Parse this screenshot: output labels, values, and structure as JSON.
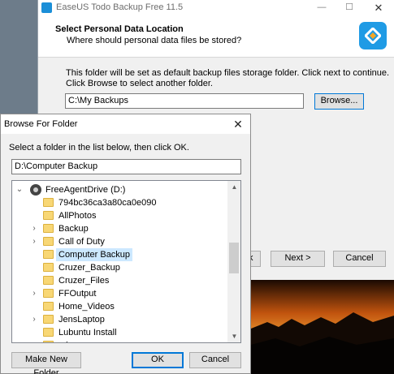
{
  "installer": {
    "title": "EaseUS Todo Backup Free 11.5",
    "heading": "Select Personal Data Location",
    "subheading": "Where should personal data files be stored?",
    "description_line1": "This folder will be set as default backup files storage folder. Click next to continue.",
    "description_line2": "Click Browse to select another folder.",
    "path_value": "C:\\My Backups",
    "browse_label": "Browse...",
    "back_label": "k",
    "next_label": "Next >",
    "cancel_label": "Cancel",
    "window_controls": {
      "minimize": "—",
      "maximize": "☐",
      "close": "✕"
    },
    "logo_icon": "easeus-logo-icon",
    "brand_color": "#1f9be5"
  },
  "dialog": {
    "title": "Browse For Folder",
    "close_glyph": "✕",
    "instruction": "Select a folder in the list below, then click OK.",
    "path": "D:\\Computer Backup",
    "drive": "FreeAgentDrive (D:)",
    "folders": [
      {
        "name": "794bc36ca3a80ca0e090",
        "expandable": false,
        "selected": false
      },
      {
        "name": "AllPhotos",
        "expandable": false,
        "selected": false
      },
      {
        "name": "Backup",
        "expandable": true,
        "selected": false
      },
      {
        "name": "Call of Duty",
        "expandable": true,
        "selected": false
      },
      {
        "name": "Computer Backup",
        "expandable": false,
        "selected": true
      },
      {
        "name": "Cruzer_Backup",
        "expandable": false,
        "selected": false
      },
      {
        "name": "Cruzer_Files",
        "expandable": false,
        "selected": false
      },
      {
        "name": "FFOutput",
        "expandable": true,
        "selected": false
      },
      {
        "name": "Home_Videos",
        "expandable": false,
        "selected": false
      },
      {
        "name": "JensLaptop",
        "expandable": true,
        "selected": false
      },
      {
        "name": "Lubuntu Install",
        "expandable": false,
        "selected": false
      },
      {
        "name": "misc",
        "expandable": false,
        "selected": false
      }
    ],
    "make_folder_label": "Make New Folder",
    "ok_label": "OK",
    "cancel_label": "Cancel",
    "selection_color": "#cce8ff",
    "folder_color": "#f8d775"
  }
}
